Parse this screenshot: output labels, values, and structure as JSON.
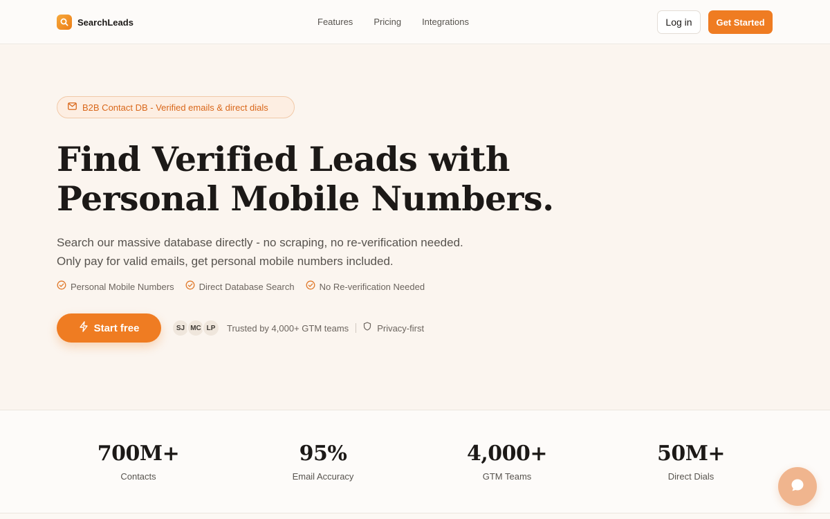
{
  "nav": {
    "brand": "SearchLeads",
    "links": [
      "Features",
      "Pricing",
      "Integrations"
    ],
    "login_label": "Log in",
    "get_started_label": "Get Started"
  },
  "hero": {
    "badge_text": "B2B Contact DB - Verified emails & direct dials",
    "badge_icon": "mail-icon",
    "headline_lines": [
      "Find Verified Leads with",
      "Personal Mobile Numbers."
    ],
    "subtext_lines": [
      "Search our massive database directly - no scraping, no re-verification needed.",
      "Only pay for valid emails, get personal mobile numbers included."
    ],
    "features": [
      "Personal Mobile Numbers",
      "Direct Database Search",
      "No Re-verification Needed"
    ],
    "cta_label": "Start free",
    "avatars": [
      "SJ",
      "MC",
      "LP"
    ],
    "trust_text": "Trusted by 4,000+ GTM teams",
    "privacy_text": "Privacy-first"
  },
  "stats": [
    {
      "value": "700M+",
      "label": "Contacts"
    },
    {
      "value": "95%",
      "label": "Email Accuracy"
    },
    {
      "value": "4,000+",
      "label": "GTM Teams"
    },
    {
      "value": "50M+",
      "label": "Direct Dials"
    }
  ],
  "colors": {
    "accent": "#ef7c22",
    "background": "#fbf5ef",
    "text": "#1c1917"
  }
}
